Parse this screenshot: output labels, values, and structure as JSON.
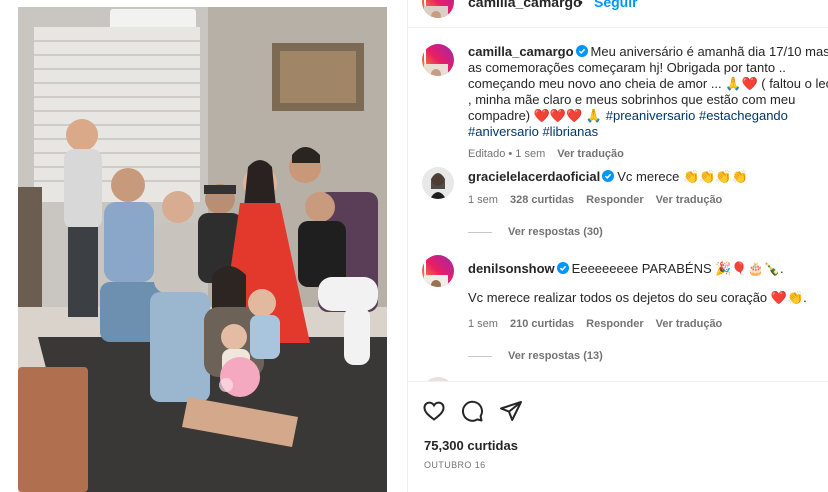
{
  "post": {
    "author": "camilla_camargo",
    "follow_label": "Seguir",
    "separator": "•",
    "caption": {
      "username": "camilla_camargo",
      "text": "Meu aniversário é amanhã dia 17/10 mas as comemorações começaram hj! Obrigada por tanto .. começando meu novo ano cheia de amor ... 🙏❤️ ( faltou o leo , minha mãe claro e meus sobrinhos que estão com meu compadre) ❤️❤️❤️ 🙏",
      "hashtags": [
        "#preaniversario",
        "#estachegando",
        "#aniversario",
        "#librianas"
      ],
      "time": "Editado • 1 sem",
      "translate_label": "Ver tradução"
    },
    "comments": [
      {
        "username": "gracielelacerdaoficial",
        "text": "Vc merece 👏👏👏👏",
        "time": "1 sem",
        "likes": "328 curtidas",
        "reply_label": "Responder",
        "translate_label": "Ver tradução",
        "view_replies": "Ver respostas (30)"
      },
      {
        "username": "denilsonshow",
        "text": "Eeeeeeeee PARABÉNS 🎉🎈🎂🍾.",
        "text2": "Vc merece realizar todos os dejetos do seu coração ❤️👏.",
        "time": "1 sem",
        "likes": "210 curtidas",
        "reply_label": "Responder",
        "translate_label": "Ver tradução",
        "view_replies": "Ver respostas (13)"
      }
    ],
    "likes_total": "75,300 curtidas",
    "date": "OUTUBRO 16"
  },
  "icons": {
    "like": "heart-outline-icon",
    "comment": "comment-bubble-icon",
    "share": "paper-plane-icon",
    "verified": "verified-badge-icon"
  },
  "colors": {
    "link_blue": "#0095f6",
    "hashtag": "#00376b",
    "secondary": "#737373",
    "verified": "#0095f6"
  }
}
